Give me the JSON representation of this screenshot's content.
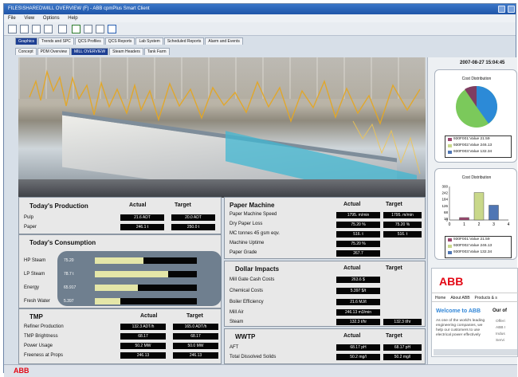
{
  "window": {
    "title": "FILES\\SHARED\\MILL OVERVIEW (F) - ABB cpmPlus Smart Client"
  },
  "menu": [
    "File",
    "View",
    "Options",
    "Help"
  ],
  "main_tabs": [
    "Graphics",
    "Trends and SPC",
    "QCS Profiles",
    "QCS Reports",
    "Lab System",
    "Scheduled Reports",
    "Alarm and Events"
  ],
  "sub_tabs": [
    "Concept",
    "PDM Overview",
    "MILL OVERVIEW",
    "Steam Headers",
    "Tank Farm"
  ],
  "timestamp": "2007-08-27 15:04:45",
  "production": {
    "title": "Today's Production",
    "actual": "Actual",
    "target": "Target",
    "rows": [
      {
        "label": "Pulp",
        "actual": "21.6 ADT",
        "target": "20.0 ADT"
      },
      {
        "label": "Paper",
        "actual": "246.1 t",
        "target": "250.0 t"
      }
    ]
  },
  "consumption": {
    "title": "Today's Consumption",
    "rows": [
      {
        "label": "HP Steam",
        "value": "75.20",
        "level": 0.48
      },
      {
        "label": "LP Steam",
        "value": "78.7 t",
        "level": 0.72
      },
      {
        "label": "Energy",
        "value": "65.917",
        "level": 0.42
      },
      {
        "label": "Fresh Water",
        "value": "5.397",
        "level": 0.25
      }
    ]
  },
  "tmp": {
    "title": "TMP",
    "actual": "Actual",
    "target": "Target",
    "rows": [
      {
        "label": "Refiner Production",
        "actual": "132.3 ADT/h",
        "target": "165.0 ADT/h"
      },
      {
        "label": "TMP Brightness",
        "actual": "68.17",
        "target": "68.17"
      },
      {
        "label": "Power Usage",
        "actual": "50.2 MW",
        "target": "50.0 MW"
      },
      {
        "label": "Freeness at Props",
        "actual": "246.13",
        "target": "246.13"
      }
    ]
  },
  "paper_machine": {
    "title": "Paper Machine",
    "actual": "Actual",
    "target": "Target",
    "rows": [
      {
        "label": "Paper Machine Speed",
        "actual": "1795. m/min",
        "target": "1795. m/min"
      },
      {
        "label": "Dry Paper Loss",
        "actual": "75.20 %",
        "target": "75.20 %"
      },
      {
        "label": "MC tonnes 45 gsm eqv.",
        "actual": "516. t",
        "target": "516. t"
      },
      {
        "label": "Machine Uptime",
        "actual": "75.20 %",
        "target": ""
      },
      {
        "label": "Paper Grade",
        "actual": "267.7",
        "target": ""
      }
    ]
  },
  "dollar": {
    "title": "Dollar Impacts",
    "actual": "Actual",
    "target": "Target",
    "rows": [
      {
        "label": "Mill Gate Cash Costs",
        "actual": "263.6 $",
        "target": ""
      },
      {
        "label": "Chemical Costs",
        "actual": "5.397 $/t",
        "target": ""
      },
      {
        "label": "Boiler Efficiency",
        "actual": "21.6 MJ/t",
        "target": ""
      },
      {
        "label": "Mill Air",
        "actual": "246.13 m3/min",
        "target": ""
      },
      {
        "label": "Steam",
        "actual": "132.3 t/hr",
        "target": "132.3 t/hr"
      }
    ]
  },
  "wwtp": {
    "title": "WWTP",
    "actual": "Actual",
    "target": "Target",
    "rows": [
      {
        "label": "AFT",
        "actual": "68.17 pH",
        "target": "68.17 pH"
      },
      {
        "label": "Total Dissolved Solids",
        "actual": "50.2 mg/l",
        "target": "50.2 mg/l"
      }
    ]
  },
  "cost_pie": {
    "title": "Cost Distribution",
    "legend": [
      "930F001:Value 21.59",
      "930F002:Value 246.13",
      "930F003:Value 132.34"
    ]
  },
  "chart_data": {
    "type": "bar",
    "title": "Cost Distribution",
    "categories": [
      "1",
      "2",
      "3"
    ],
    "values": [
      21.59,
      246.13,
      132.34
    ],
    "ylim": [
      0,
      300
    ],
    "yticks": [
      "300",
      "242",
      "184",
      "126",
      "68",
      "10",
      "0"
    ],
    "xticks": [
      "0",
      "1",
      "2",
      "3",
      "4"
    ],
    "colors": [
      "#9d4970",
      "#c9d88a",
      "#4f76b4"
    ],
    "legend": [
      "930F001:Value 21.59",
      "930F002:Value 246.13",
      "930F003:Value 132.34"
    ]
  },
  "web": {
    "brand": "ABB",
    "tabs": [
      "Home",
      "About ABB",
      "Products & s"
    ],
    "headline": "Welcome to ABB",
    "subhead": "Our of",
    "body": "As one of the world's leading engineering companies, we help our customers to use electrical power effectively",
    "links": [
      "Offeri",
      "ABB I",
      "Indus",
      "Servi"
    ]
  },
  "status": {
    "brand": "ABB"
  }
}
